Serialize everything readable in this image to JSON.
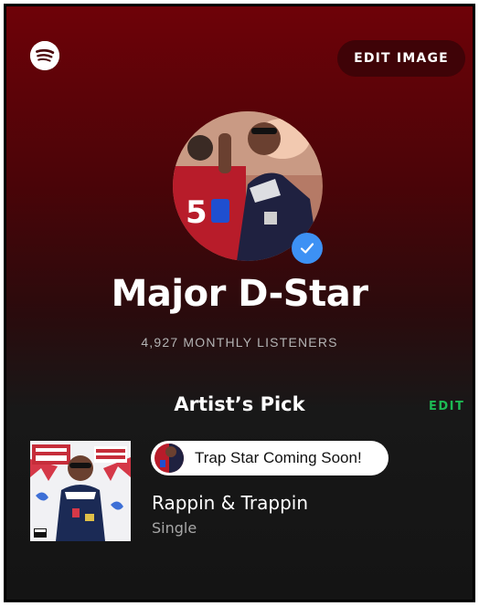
{
  "header": {
    "logo_icon": "spotify-logo-icon",
    "edit_image_label": "EDIT IMAGE"
  },
  "artist": {
    "name": "Major D-Star",
    "monthly_listeners": "4,927 MONTHLY LISTENERS",
    "verified": true
  },
  "artists_pick": {
    "title": "Artist’s Pick",
    "edit_label": "EDIT",
    "comment": "Trap Star Coming Soon!",
    "track_title": "Rappin & Trappin",
    "track_type": "Single"
  },
  "colors": {
    "accent_green": "#1db954",
    "verified_blue": "#3d91f4",
    "header_red": "#6e0208"
  }
}
